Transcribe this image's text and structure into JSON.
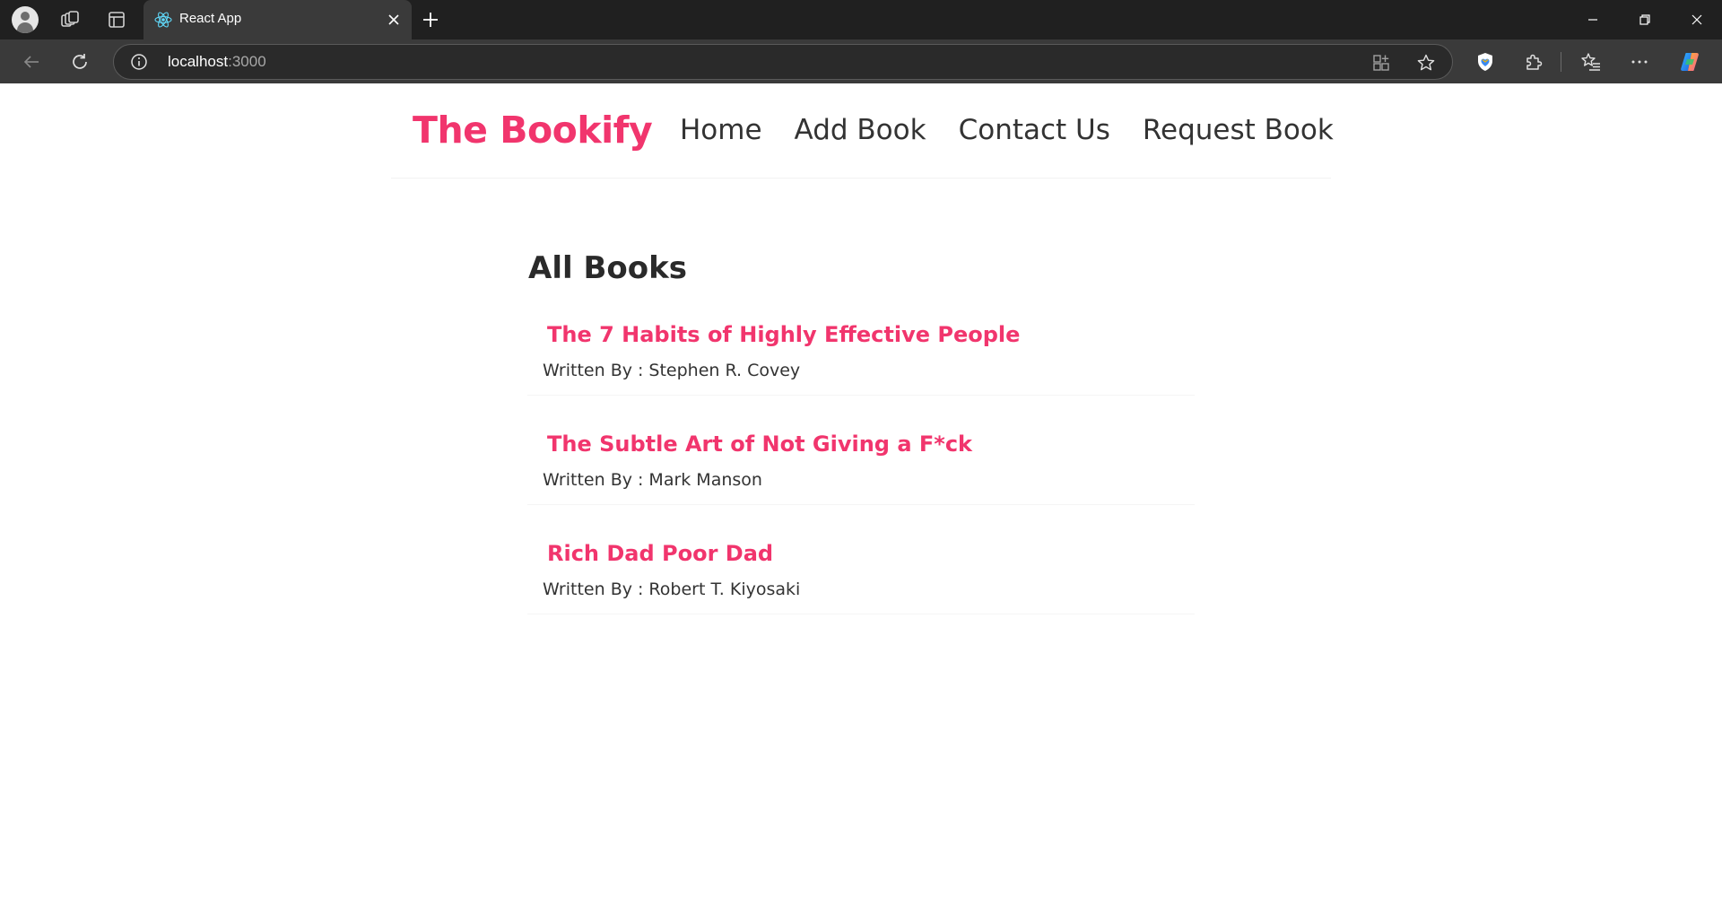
{
  "browser": {
    "tab": {
      "title": "React App"
    },
    "address": {
      "host": "localhost",
      "port": ":3000"
    },
    "icons": {
      "profile": "profile-icon",
      "workspaces": "workspaces-icon",
      "vertical_tabs": "vertical-tabs-icon",
      "favicon": "react-logo-icon",
      "close_tab": "close-icon",
      "new_tab": "plus-icon",
      "back": "arrow-left-icon",
      "reload": "reload-icon",
      "site_info": "info-icon",
      "app_available": "app-grid-icon",
      "favorite": "star-icon",
      "browser_essentials": "heart-shield-icon",
      "extensions": "puzzle-icon",
      "favorites": "favorites-list-icon",
      "more": "ellipsis-icon",
      "copilot": "copilot-icon"
    }
  },
  "navbar": {
    "brand": "The Bookify",
    "links": [
      "Home",
      "Add Book",
      "Contact Us",
      "Request Book"
    ]
  },
  "main": {
    "heading": "All Books",
    "author_prefix": "Written By :",
    "books": [
      {
        "title": "The 7 Habits of Highly Effective People",
        "author": "Stephen R. Covey"
      },
      {
        "title": "The Subtle Art of Not Giving a F*ck",
        "author": "Mark Manson"
      },
      {
        "title": "Rich Dad Poor Dad",
        "author": "Robert T. Kiyosaki"
      }
    ]
  },
  "colors": {
    "brand": "#f1356d",
    "text": "#333333",
    "chrome_dark": "#202020",
    "chrome_toolbar": "#3a3a3a"
  }
}
